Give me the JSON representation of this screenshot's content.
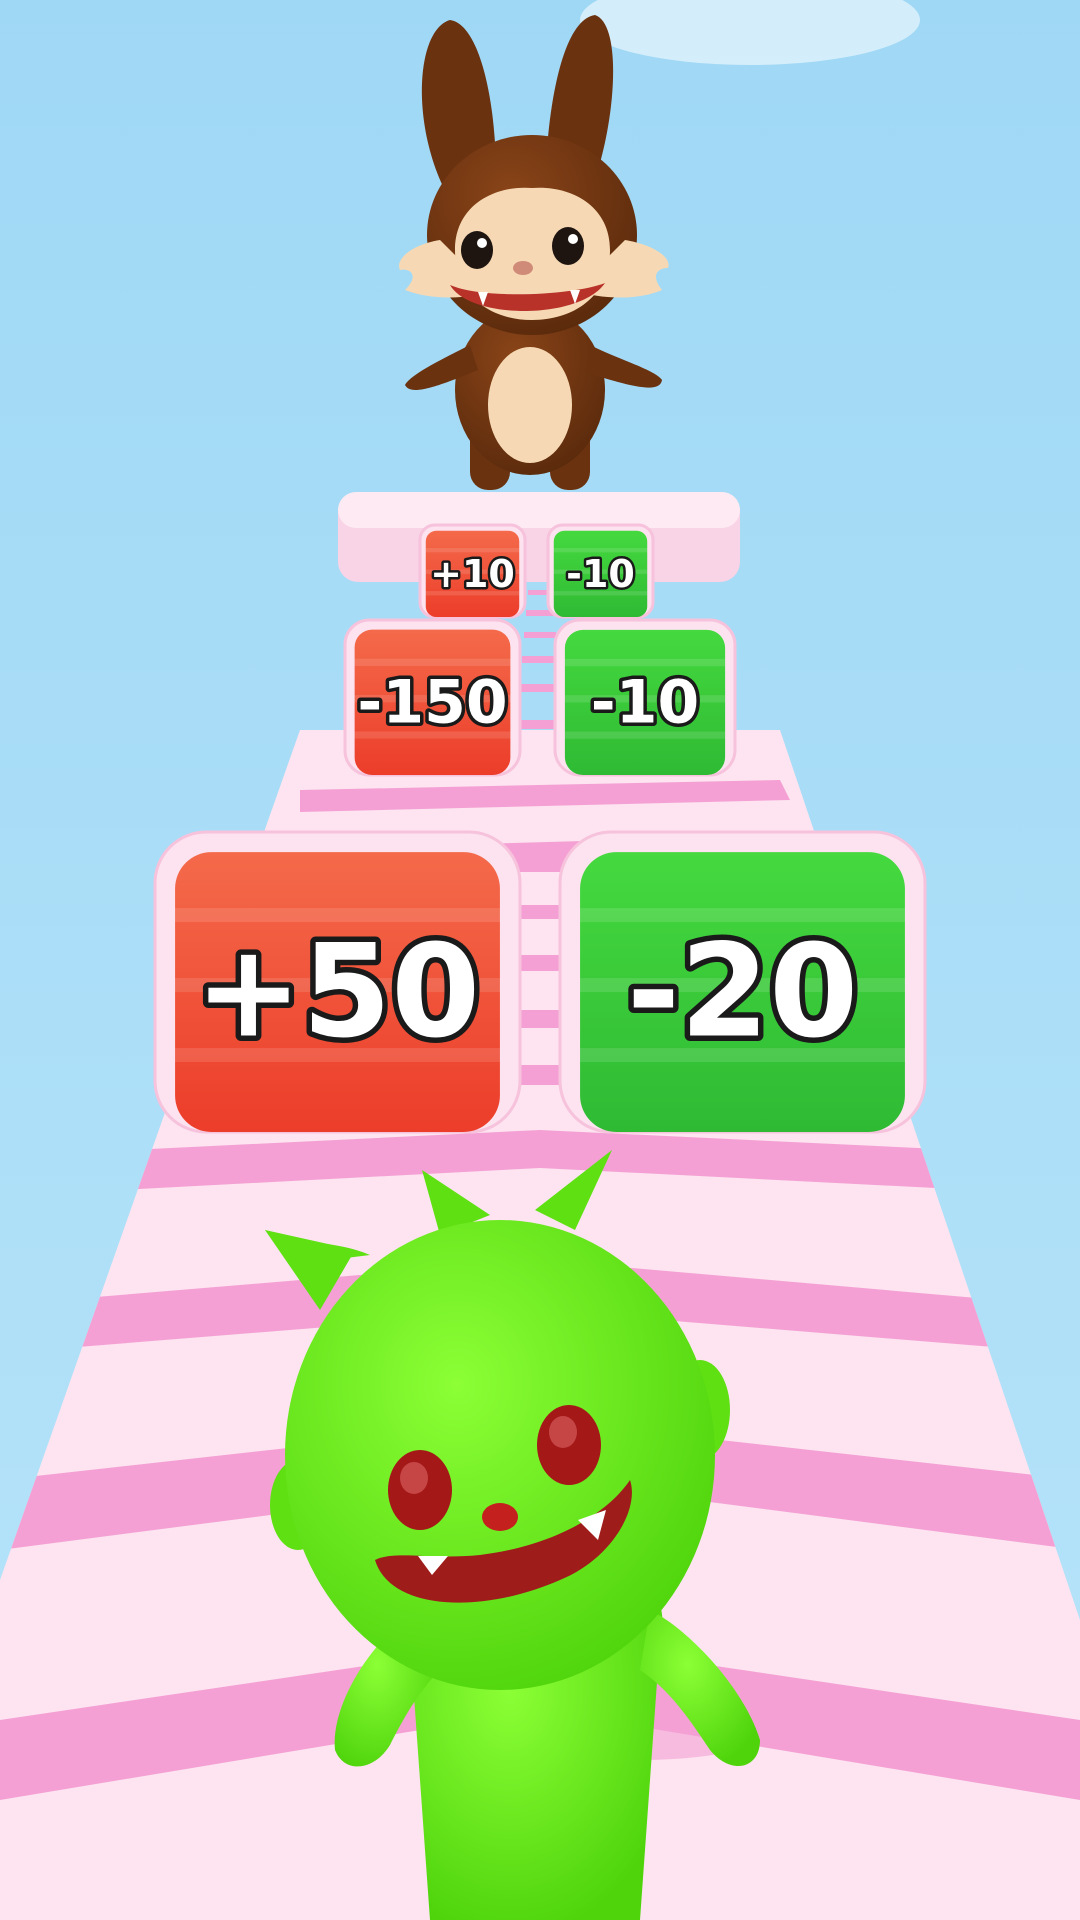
{
  "scene": {
    "sky_color": "#a9dcf6",
    "track_colors": {
      "light": "#fde4f0",
      "stripe": "#f4a0d4",
      "rail": "#f7c9e2"
    }
  },
  "gates": [
    {
      "row": "far",
      "left": {
        "label": "+10",
        "color": "#ee4a3a"
      },
      "right": {
        "label": "-10",
        "color": "#35c93a"
      }
    },
    {
      "row": "mid",
      "left": {
        "label": "-150",
        "color": "#ee4a3a"
      },
      "right": {
        "label": "-10",
        "color": "#35c93a"
      }
    },
    {
      "row": "near",
      "left": {
        "label": "+50",
        "color": "#ee4a3a"
      },
      "right": {
        "label": "-20",
        "color": "#35c93a"
      }
    }
  ],
  "characters": {
    "boss": {
      "name": "brown-rabbit-boss",
      "color": "#6b3210"
    },
    "player": {
      "name": "green-monster-player",
      "color": "#66ee16"
    }
  }
}
